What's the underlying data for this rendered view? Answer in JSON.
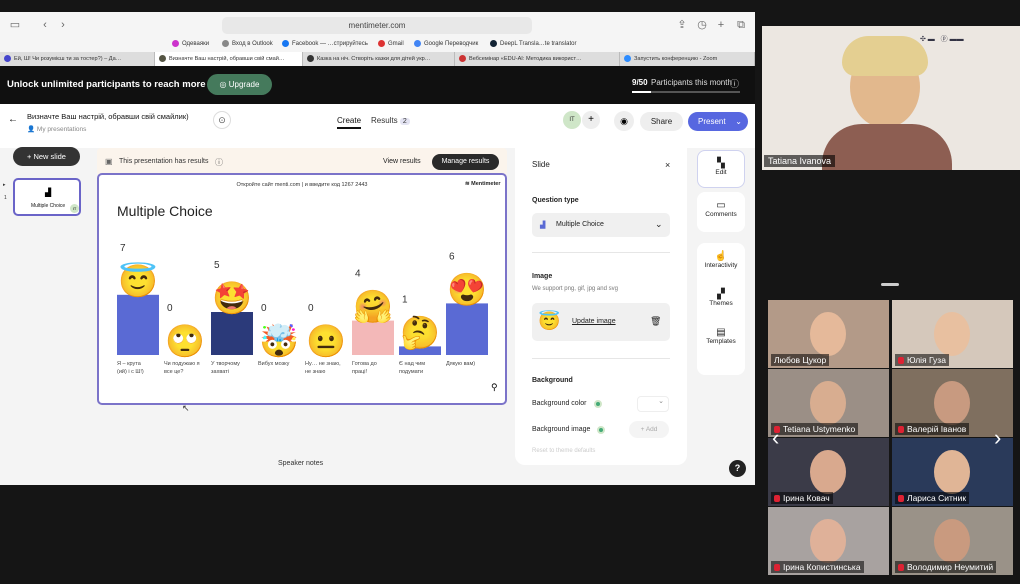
{
  "browser": {
    "url": "mentimeter.com",
    "bookmarks": [
      "Одеваяки",
      "Вход в Outlook",
      "Facebook — …стрируйтесь",
      "Gmail",
      "Google Переводчик",
      "DeepL Transla…te translator"
    ],
    "tabs": [
      "Ей, Ш! Чи розумієш ти за тостер?) – Да…",
      "Визначте Ваш настрій, обравши свій смай…",
      "Казка на ніч. Створіть казки для дітей укр…",
      "Вебсемінар «EDU-AI: Методика використ…",
      "Запустить конференцию - Zoom"
    ]
  },
  "banner": {
    "text": "Unlock unlimited participants to reach more people.",
    "upgrade_label": "Upgrade",
    "participants_count": "9/50",
    "participants_label": "Participants this month",
    "progress_fraction": 0.18
  },
  "header": {
    "title": "Визначте Ваш настрій, обравши свій смайлик)",
    "breadcrumb": "My presentations",
    "tab_create": "Create",
    "tab_results": "Results",
    "results_count": "2",
    "avatar_initials": "IT",
    "share_label": "Share",
    "present_label": "Present"
  },
  "left": {
    "new_slide_label": "+ New slide",
    "slide_number": "1",
    "thumb_label": "Multiple Choice",
    "thumb_avatar": "IT"
  },
  "results_bar": {
    "text": "This presentation has results",
    "view_label": "View results",
    "manage_label": "Manage results"
  },
  "slide": {
    "top_text": "Откройте сайт menti.com | и введите код  1267 2443",
    "brand": "Mentimeter",
    "title": "Multiple Choice",
    "speaker_notes": "Speaker notes"
  },
  "chart_data": {
    "type": "bar",
    "title": "Multiple Choice",
    "categories": [
      "Я – крута (ий) і с Ш!)",
      "Чи подужаю я все це?",
      "У творчому захваті",
      "Вибух мозку",
      "Ну… не знаю, не знаю",
      "Готова до праці!",
      "Є над чим подумати",
      "Дякую вам)"
    ],
    "values": [
      7,
      0,
      5,
      0,
      0,
      4,
      1,
      6
    ],
    "colors": [
      "#5a6ad4",
      "#5a6ad4",
      "#2b3a7a",
      "#5a6ad4",
      "#5a6ad4",
      "#f3b8b8",
      "#5a6ad4",
      "#5a6ad4"
    ],
    "emojis": [
      "😇",
      "🙄",
      "🤩",
      "🤯",
      "😐",
      "🤗",
      "🤔",
      "😍"
    ]
  },
  "panel": {
    "title": "Slide",
    "question_type_label": "Question type",
    "question_type_value": "Multiple Choice",
    "image_label": "Image",
    "image_hint": "We support png, gif, jpg and svg",
    "update_image": "Update image",
    "background_label": "Background",
    "bg_color_label": "Background color",
    "bg_image_label": "Background image",
    "add_label": "+ Add",
    "reset_label": "Reset to theme defaults"
  },
  "side_tools": [
    "Edit",
    "Comments",
    "Interactivity",
    "Themes",
    "Templates"
  ],
  "help_label": "?",
  "speaker": {
    "name": "Tatiana Ivanova"
  },
  "participants": [
    "Любов Цукор",
    "Юлія Гуза",
    "Tetiana Ustymenko",
    "Валерій Іванов",
    "Ірина Ковач",
    "Лариса Ситник",
    "Ірина Копистинська",
    "Володимир Неумитий"
  ]
}
